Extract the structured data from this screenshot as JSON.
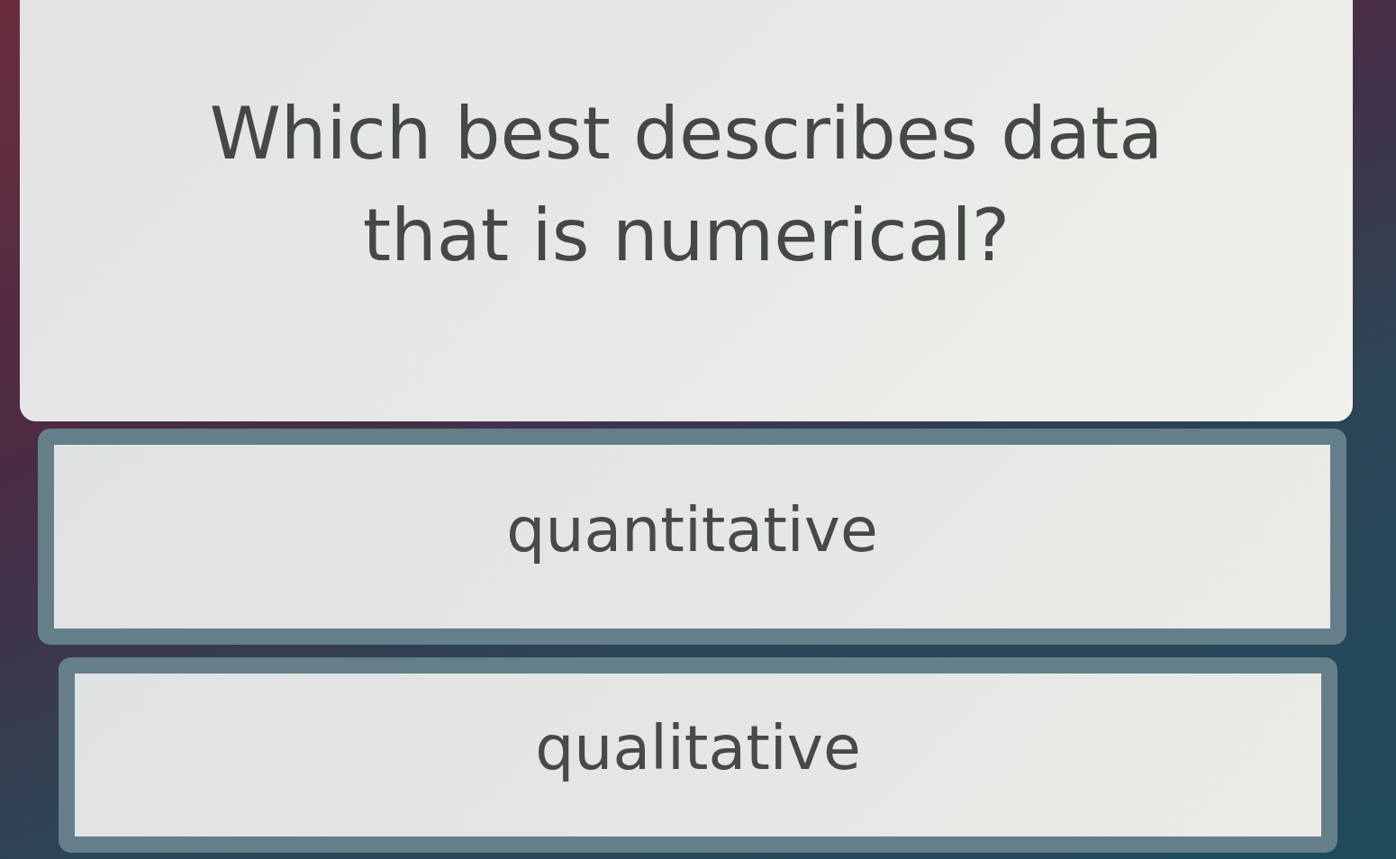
{
  "question": {
    "text": "Which best describes data that is numerical?"
  },
  "options": [
    {
      "label": "quantitative",
      "selected": false
    },
    {
      "label": "qualitative",
      "selected": false
    }
  ]
}
